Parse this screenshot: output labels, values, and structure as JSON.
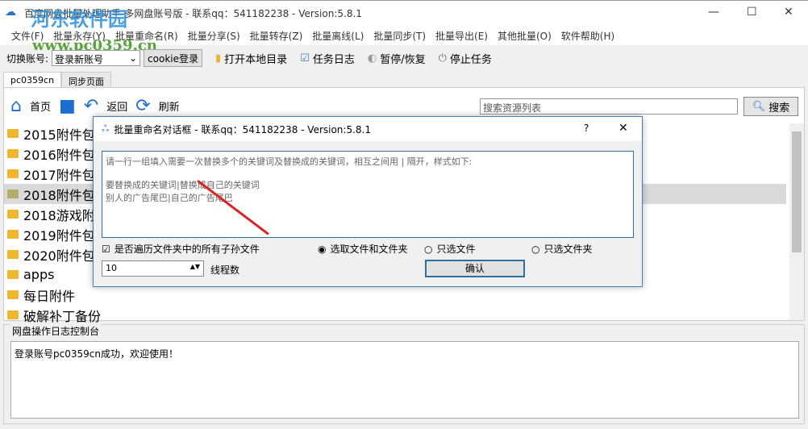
{
  "window": {
    "title": "百度网盘批量处理助手-多网盘账号版 - 联系qq：541182238 - Version:5.8.1",
    "watermark": "河东软件园",
    "watermark_url": "www.pc0359.cn"
  },
  "menu": [
    "文件(F)",
    "批量永存(Y)",
    "批量重命名(R)",
    "批量分享(S)",
    "批量转存(Z)",
    "批量离线(L)",
    "批量同步(T)",
    "批量导出(E)",
    "其他批量(O)",
    "软件帮助(H)"
  ],
  "toolbar": {
    "switch_label": "切换账号:",
    "account": "登录新账号",
    "cookie": "cookie登录",
    "open_dir": "打开本地目录",
    "task_log": "任务日志",
    "pause": "暂停/恢复",
    "stop": "停止任务"
  },
  "tabs": [
    "pc0359cn",
    "同步页面"
  ],
  "nav": {
    "home": "首页",
    "back": "返回",
    "refresh": "刷新",
    "search_placeholder": "搜索资源列表",
    "search": "搜索"
  },
  "files": [
    "2015附件包",
    "2016附件包",
    "2017附件包",
    "2018附件包",
    "2018游戏附件",
    "2019附件包",
    "2020附件包",
    "apps",
    "每日附件",
    "破解补丁备份"
  ],
  "log": {
    "title": "网盘操作日志控制台",
    "text": "登录账号pc0359cn成功，欢迎使用！"
  },
  "dialog": {
    "title": "批量重命名对话框 - 联系qq：541182238 - Version:5.8.1",
    "help": "?",
    "close": "✕",
    "text": "请一行一组填入需要一次替换多个的关键词及替换成的关键词，相互之间用 | 隔开，样式如下:\n\n要替换成的关键词|替换成自己的关键词\n别人的广告尾巴|自己的广告尾巴",
    "recursive": "是否遍历文件夹中的所有子孙文件",
    "opt_both": "选取文件和文件夹",
    "opt_files": "只选文件",
    "opt_folders": "只选文件夹",
    "threads": "10",
    "threads_label": "线程数",
    "ok": "确认"
  }
}
